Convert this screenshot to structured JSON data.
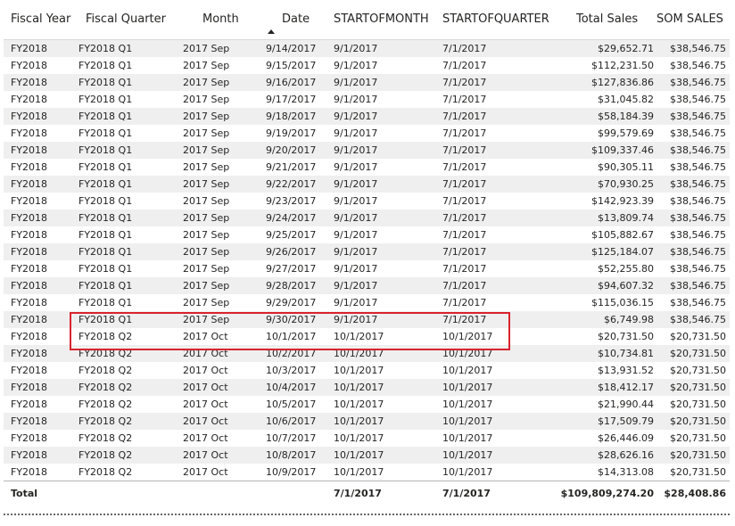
{
  "columns": [
    "Fiscal Year",
    "Fiscal Quarter",
    "Month",
    "Date",
    "STARTOFMONTH",
    "STARTOFQUARTER",
    "Total Sales",
    "SOM SALES"
  ],
  "sorted_column": "Date",
  "rows": [
    [
      "FY2018",
      "FY2018 Q1",
      "2017 Sep",
      "9/14/2017",
      "9/1/2017",
      "7/1/2017",
      "$29,652.71",
      "$38,546.75"
    ],
    [
      "FY2018",
      "FY2018 Q1",
      "2017 Sep",
      "9/15/2017",
      "9/1/2017",
      "7/1/2017",
      "$112,231.50",
      "$38,546.75"
    ],
    [
      "FY2018",
      "FY2018 Q1",
      "2017 Sep",
      "9/16/2017",
      "9/1/2017",
      "7/1/2017",
      "$127,836.86",
      "$38,546.75"
    ],
    [
      "FY2018",
      "FY2018 Q1",
      "2017 Sep",
      "9/17/2017",
      "9/1/2017",
      "7/1/2017",
      "$31,045.82",
      "$38,546.75"
    ],
    [
      "FY2018",
      "FY2018 Q1",
      "2017 Sep",
      "9/18/2017",
      "9/1/2017",
      "7/1/2017",
      "$58,184.39",
      "$38,546.75"
    ],
    [
      "FY2018",
      "FY2018 Q1",
      "2017 Sep",
      "9/19/2017",
      "9/1/2017",
      "7/1/2017",
      "$99,579.69",
      "$38,546.75"
    ],
    [
      "FY2018",
      "FY2018 Q1",
      "2017 Sep",
      "9/20/2017",
      "9/1/2017",
      "7/1/2017",
      "$109,337.46",
      "$38,546.75"
    ],
    [
      "FY2018",
      "FY2018 Q1",
      "2017 Sep",
      "9/21/2017",
      "9/1/2017",
      "7/1/2017",
      "$90,305.11",
      "$38,546.75"
    ],
    [
      "FY2018",
      "FY2018 Q1",
      "2017 Sep",
      "9/22/2017",
      "9/1/2017",
      "7/1/2017",
      "$70,930.25",
      "$38,546.75"
    ],
    [
      "FY2018",
      "FY2018 Q1",
      "2017 Sep",
      "9/23/2017",
      "9/1/2017",
      "7/1/2017",
      "$142,923.39",
      "$38,546.75"
    ],
    [
      "FY2018",
      "FY2018 Q1",
      "2017 Sep",
      "9/24/2017",
      "9/1/2017",
      "7/1/2017",
      "$13,809.74",
      "$38,546.75"
    ],
    [
      "FY2018",
      "FY2018 Q1",
      "2017 Sep",
      "9/25/2017",
      "9/1/2017",
      "7/1/2017",
      "$105,882.67",
      "$38,546.75"
    ],
    [
      "FY2018",
      "FY2018 Q1",
      "2017 Sep",
      "9/26/2017",
      "9/1/2017",
      "7/1/2017",
      "$125,184.07",
      "$38,546.75"
    ],
    [
      "FY2018",
      "FY2018 Q1",
      "2017 Sep",
      "9/27/2017",
      "9/1/2017",
      "7/1/2017",
      "$52,255.80",
      "$38,546.75"
    ],
    [
      "FY2018",
      "FY2018 Q1",
      "2017 Sep",
      "9/28/2017",
      "9/1/2017",
      "7/1/2017",
      "$94,607.32",
      "$38,546.75"
    ],
    [
      "FY2018",
      "FY2018 Q1",
      "2017 Sep",
      "9/29/2017",
      "9/1/2017",
      "7/1/2017",
      "$115,036.15",
      "$38,546.75"
    ],
    [
      "FY2018",
      "FY2018 Q1",
      "2017 Sep",
      "9/30/2017",
      "9/1/2017",
      "7/1/2017",
      "$6,749.98",
      "$38,546.75"
    ],
    [
      "FY2018",
      "FY2018 Q2",
      "2017 Oct",
      "10/1/2017",
      "10/1/2017",
      "10/1/2017",
      "$20,731.50",
      "$20,731.50"
    ],
    [
      "FY2018",
      "FY2018 Q2",
      "2017 Oct",
      "10/2/2017",
      "10/1/2017",
      "10/1/2017",
      "$10,734.81",
      "$20,731.50"
    ],
    [
      "FY2018",
      "FY2018 Q2",
      "2017 Oct",
      "10/3/2017",
      "10/1/2017",
      "10/1/2017",
      "$13,931.52",
      "$20,731.50"
    ],
    [
      "FY2018",
      "FY2018 Q2",
      "2017 Oct",
      "10/4/2017",
      "10/1/2017",
      "10/1/2017",
      "$18,412.17",
      "$20,731.50"
    ],
    [
      "FY2018",
      "FY2018 Q2",
      "2017 Oct",
      "10/5/2017",
      "10/1/2017",
      "10/1/2017",
      "$21,990.44",
      "$20,731.50"
    ],
    [
      "FY2018",
      "FY2018 Q2",
      "2017 Oct",
      "10/6/2017",
      "10/1/2017",
      "10/1/2017",
      "$17,509.79",
      "$20,731.50"
    ],
    [
      "FY2018",
      "FY2018 Q2",
      "2017 Oct",
      "10/7/2017",
      "10/1/2017",
      "10/1/2017",
      "$26,446.09",
      "$20,731.50"
    ],
    [
      "FY2018",
      "FY2018 Q2",
      "2017 Oct",
      "10/8/2017",
      "10/1/2017",
      "10/1/2017",
      "$28,626.16",
      "$20,731.50"
    ],
    [
      "FY2018",
      "FY2018 Q2",
      "2017 Oct",
      "10/9/2017",
      "10/1/2017",
      "10/1/2017",
      "$14,313.08",
      "$20,731.50"
    ]
  ],
  "totals": {
    "label": "Total",
    "startofmonth": "7/1/2017",
    "startofquarter": "7/1/2017",
    "total_sales": "$109,809,274.20",
    "som_sales": "$28,408.86"
  },
  "colors": {
    "highlight_border": "#d9232e",
    "row_band": "#efefef"
  }
}
